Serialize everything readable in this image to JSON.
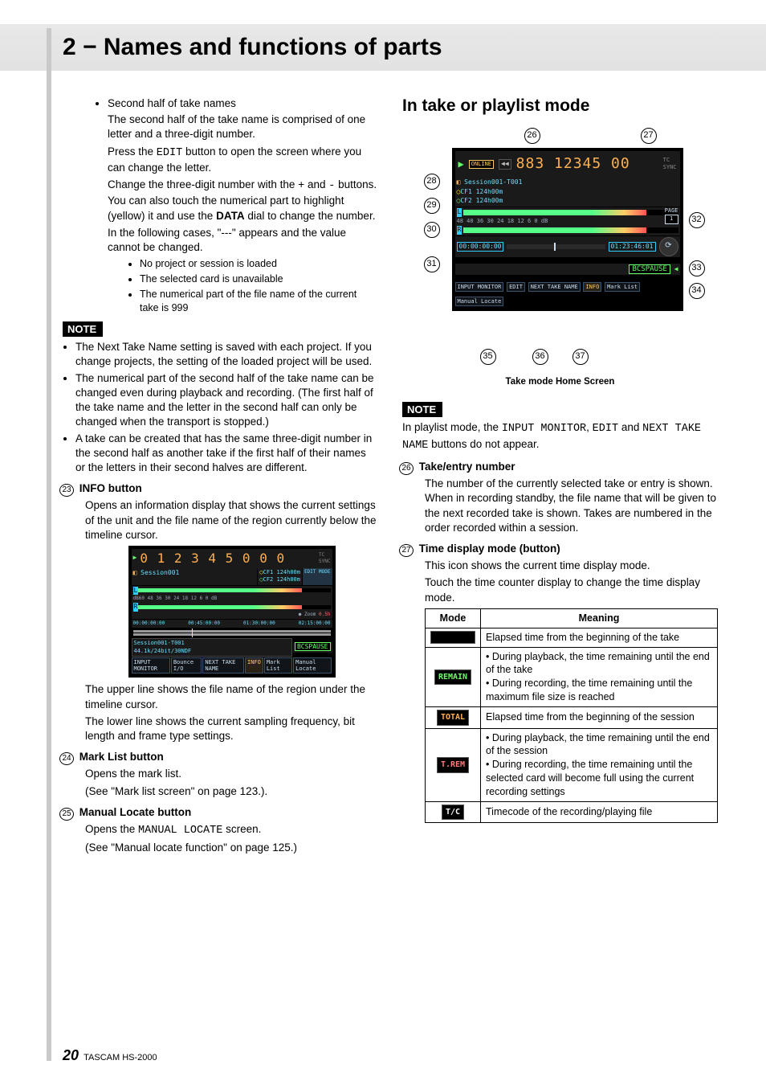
{
  "header": "2 − Names and functions of parts",
  "left": {
    "bullet1_title": "Second half of take names",
    "p1": "The second half of the take name is comprised of one letter and a three-digit number.",
    "p2a": "Press the ",
    "p2_mono": "EDIT",
    "p2b": " button to open the screen where you can change the letter.",
    "p3a": "Change the three-digit number with the ",
    "p3_plus": "+",
    "p3_mid": " and ",
    "p3_minus": "-",
    "p3b": " buttons. You can also touch the numerical part to highlight (yellow) it and use the ",
    "p3_data": "DATA",
    "p3c": " dial to change the number.",
    "p4": "In the following cases, \"---\" appears and the value cannot be changed.",
    "cases": [
      "No project or session is loaded",
      "The selected card is unavailable",
      "The numerical part of the file name of the current take is 999"
    ],
    "note_label": "NOTE",
    "notes": [
      "The Next Take Name setting is saved with each project. If you change projects, the setting of the loaded project will be used.",
      "The numerical part of the second half of the take name can be changed even during playback and recording. (The first half of the take name and the letter in the second half can only be changed when the transport is stopped.)",
      "A take can be created that has the same three-digit number in the second half as another take if the first half of their names or the letters in their second halves are different."
    ],
    "info_num": "23",
    "info_title": "INFO button",
    "info_p1": "Opens an information display that shows the current settings of the unit and the file name of the region currently below the timeline cursor.",
    "info_p2": "The upper line shows the file name of the region under the timeline cursor.",
    "info_p3": "The lower line shows the current sampling frequency, bit length and frame type settings.",
    "mark_num": "24",
    "mark_title": "Mark List button",
    "mark_p1": "Opens the mark list.",
    "mark_p2": "(See \"Mark list screen\" on page 123.).",
    "ml_num": "25",
    "ml_title": "Manual Locate button",
    "ml_p1a": "Opens the ",
    "ml_mono": "MANUAL LOCATE",
    "ml_p1b": " screen.",
    "ml_p2": "(See \"Manual locate function\" on page 125.)",
    "screenshot": {
      "time": "0 1 2 3 4 5 0 0 0",
      "session": "Session001",
      "cf1": "CF1 124h00m",
      "cf2": "CF2 124h00m",
      "edit_mode": "EDIT MODE",
      "scale": "dB60 48 36   30   24   18   12   6   0 dB",
      "t1": "00:00:00:00",
      "t2": "00:45:00:00",
      "t3": "01:30:00:00",
      "t4": "02:15:00:00",
      "region": "Session001-T001",
      "fmt": "44.1k/24bit/30NDF",
      "bc": "BCSPAUSE",
      "btns": [
        "INPUT MONITOR",
        "Bounce I/O",
        "NEXT TAKE NAME",
        "INFO",
        "Mark List",
        "Manual Locate"
      ]
    }
  },
  "right": {
    "section": "In take or playlist mode",
    "caption": "Take mode Home Screen",
    "note_label": "NOTE",
    "note_a": "In playlist mode, the ",
    "note_m1": "INPUT MONITOR",
    "note_sep1": ", ",
    "note_m2": "EDIT",
    "note_sep2": " and ",
    "note_m3": "NEXT TAKE NAME",
    "note_b": " buttons do not appear.",
    "i26_num": "26",
    "i26_title": "Take/entry number",
    "i26_p": "The number of the currently selected take or entry is shown. When in recording standby, the file name that will be given to the next recorded take is shown. Takes are numbered in the order recorded within a session.",
    "i27_num": "27",
    "i27_title": "Time display mode (button)",
    "i27_p1": "This icon shows the current time display mode.",
    "i27_p2": "Touch the time counter display to change the time display mode.",
    "table_head_mode": "Mode",
    "table_head_meaning": "Meaning",
    "rows": [
      {
        "chip": "",
        "cls": "blank",
        "meaning": "Elapsed time from the beginning of the take"
      },
      {
        "chip": "REMAIN",
        "cls": "green",
        "meaning": "• During playback, the time remaining until the end of the take\n• During recording, the time remaining until the maximum file size is reached"
      },
      {
        "chip": "TOTAL",
        "cls": "orange",
        "meaning": "Elapsed time from the beginning of the session"
      },
      {
        "chip": "T.REM",
        "cls": "red",
        "meaning": "• During playback, the time remaining until the end of the session\n• During recording, the time remaining until the selected card will become full using the current recording settings"
      },
      {
        "chip": "T/C",
        "cls": "white",
        "meaning": "Timecode of the recording/playing file"
      }
    ],
    "diagram": {
      "title": "883 12345 00",
      "session": "Session001-T001",
      "cf1": "CF1 124h00m",
      "cf2": "CF2 124h00m",
      "scale": "48 40 36   30   24   18   12   6   0 dB",
      "pageLbl": "PAGE",
      "pageNum": "1",
      "t1": "00:00:00:00",
      "t2": "01:23:46:01",
      "bc": "BCSPAUSE",
      "btns": [
        "INPUT MONITOR",
        "EDIT",
        "NEXT TAKE NAME",
        "INFO",
        "Mark List",
        "Manual Locate"
      ]
    },
    "callouts": {
      "c26": "26",
      "c27": "27",
      "c28": "28",
      "c29": "29",
      "c30": "30",
      "c31": "31",
      "c32": "32",
      "c33": "33",
      "c34": "34",
      "c35": "35",
      "c36": "36",
      "c37": "37"
    }
  },
  "footer": {
    "page": "20",
    "model": "TASCAM HS-2000"
  }
}
